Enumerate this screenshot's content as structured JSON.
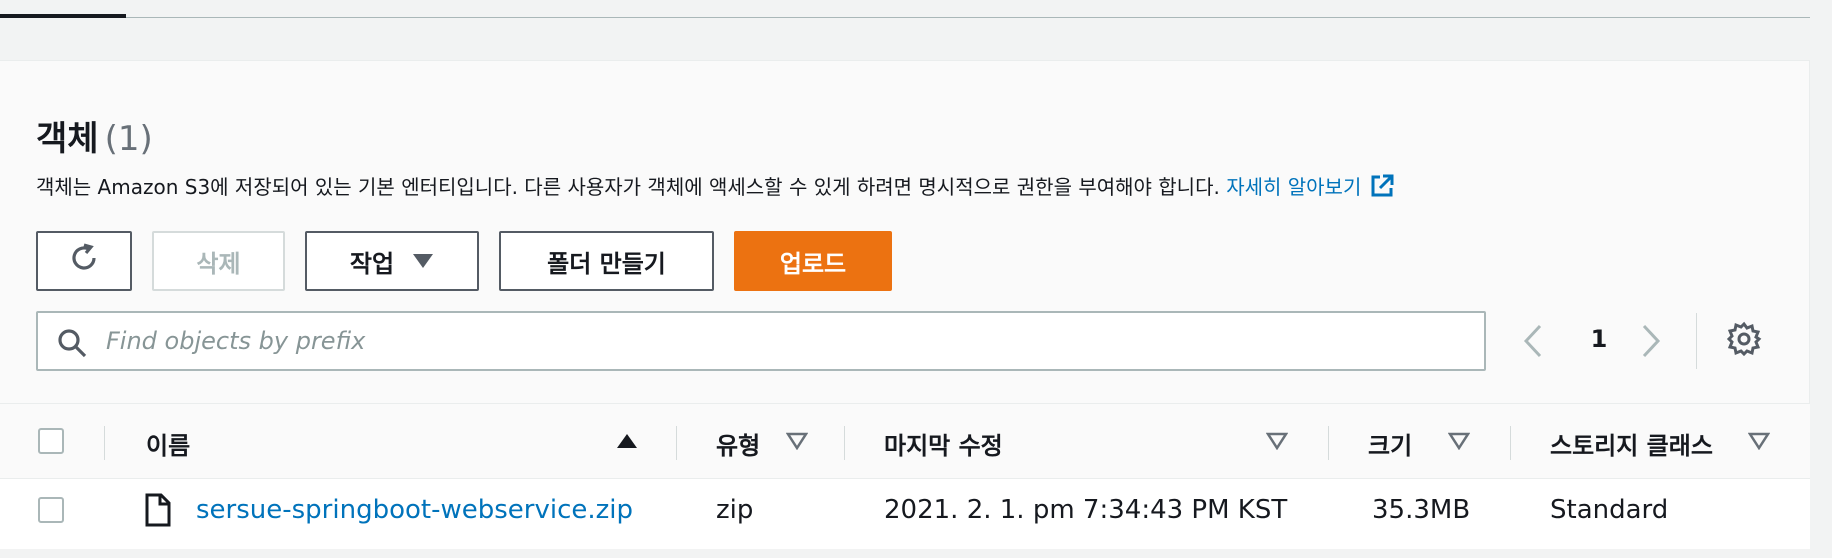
{
  "objects": {
    "title": "객체",
    "count": "(1)",
    "description": "객체는 Amazon S3에 저장되어 있는 기본 엔터티입니다. 다른 사용자가 객체에 액세스할 수 있게 하려면 명시적으로 권한을 부여해야 합니다.",
    "learn_more": "자세히 알아보기"
  },
  "toolbar": {
    "refresh_icon": "refresh-icon",
    "delete_label": "삭제",
    "actions_label": "작업",
    "create_folder_label": "폴더 만들기",
    "upload_label": "업로드"
  },
  "search": {
    "placeholder": "Find objects by prefix",
    "value": ""
  },
  "pagination": {
    "current_page": "1"
  },
  "table": {
    "columns": [
      "이름",
      "유형",
      "마지막 수정",
      "크기",
      "스토리지 클래스"
    ],
    "rows": [
      {
        "name": "sersue-springboot-webservice.zip",
        "type": "zip",
        "last_modified": "2021. 2. 1. pm 7:34:43 PM KST",
        "size": "35.3MB",
        "storage_class": "Standard"
      }
    ]
  },
  "colors": {
    "accent_orange": "#ec7211",
    "link_blue": "#0073bb",
    "text_dark": "#16191f",
    "disabled_gray": "#aab7b8"
  }
}
